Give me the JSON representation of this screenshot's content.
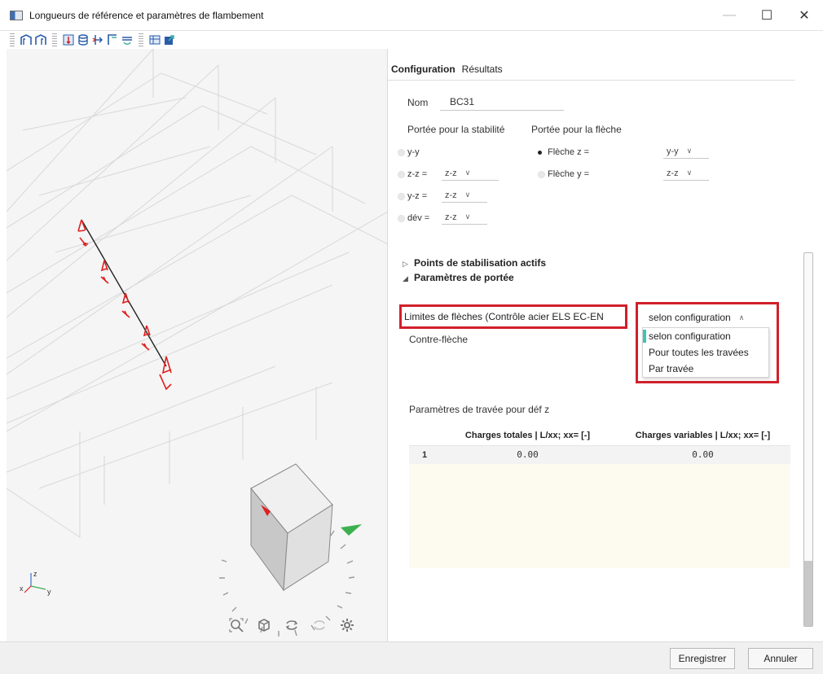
{
  "window": {
    "title": "Longueurs de référence et paramètres de flambement",
    "minimize": "—",
    "maximize": "☐",
    "close": "✕"
  },
  "toolbar": {
    "icons": [
      "frame-icon",
      "frame-alt-icon",
      "member-icon",
      "database-icon",
      "support-icon",
      "beam-end-icon",
      "view-icon",
      "table-icon",
      "export-icon"
    ]
  },
  "viewport": {
    "axis_labels": {
      "x": "x",
      "y": "y",
      "z": "z"
    },
    "tools": [
      "zoom-fit-icon",
      "cube-view-icon",
      "rotate-icon",
      "rotate-alt-icon",
      "settings-icon"
    ]
  },
  "tabs": [
    {
      "label": "Configuration",
      "active": true
    },
    {
      "label": "Résultats",
      "active": false
    }
  ],
  "form": {
    "nom_label": "Nom",
    "nom_value": "BC31",
    "stability_title": "Portée pour la stabilité",
    "deflection_title": "Portée pour la flèche",
    "stability_options": [
      {
        "label": "y-y",
        "selected": false,
        "combo": ""
      },
      {
        "label": "z-z =",
        "selected": false,
        "combo": "z-z"
      },
      {
        "label": "y-z =",
        "selected": false,
        "combo": "z-z"
      },
      {
        "label": "dév =",
        "selected": false,
        "combo": "z-z"
      }
    ],
    "deflection_options": [
      {
        "label": "Flèche z =",
        "selected": true,
        "combo": "y-y"
      },
      {
        "label": "Flèche y =",
        "selected": false,
        "combo": "z-z"
      }
    ]
  },
  "sections": {
    "points": "Points de stabilisation actifs",
    "params": "Paramètres de portée"
  },
  "limits": {
    "label": "Limites de flèches (Contrôle acier ELS EC-EN",
    "selected": "selon configuration",
    "options": [
      "selon configuration",
      "Pour toutes les travées",
      "Par travée"
    ],
    "contre_fleche_label": "Contre-flèche"
  },
  "span_params": {
    "title": "Paramètres de travée pour déf z",
    "columns": [
      "Charges totales | L/xx; xx= [-]",
      "Charges variables | L/xx; xx= [-]"
    ],
    "rows": [
      {
        "index": "1",
        "cells": [
          "0.00",
          "0.00"
        ]
      }
    ]
  },
  "footer": {
    "save_label": "Enregistrer",
    "cancel_label": "Annuler"
  },
  "colors": {
    "highlight_red": "#d0202a",
    "selection_teal": "#3cc4b8",
    "member_red": "#e02020"
  }
}
